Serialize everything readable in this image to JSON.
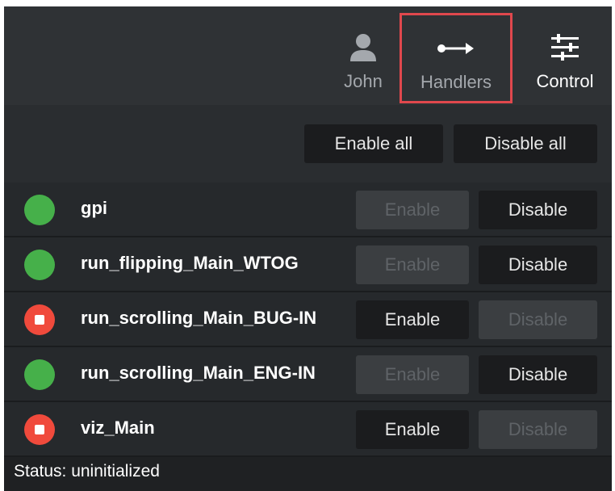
{
  "nav": {
    "user_label": "John",
    "handlers_label": "Handlers",
    "control_label": "Control"
  },
  "bulk": {
    "enable_all": "Enable all",
    "disable_all": "Disable all"
  },
  "handlers": [
    {
      "name": "gpi",
      "status": "running",
      "enable_label": "Enable",
      "disable_label": "Disable"
    },
    {
      "name": "run_flipping_Main_WTOG",
      "status": "running",
      "enable_label": "Enable",
      "disable_label": "Disable"
    },
    {
      "name": "run_scrolling_Main_BUG-IN",
      "status": "stopped",
      "enable_label": "Enable",
      "disable_label": "Disable"
    },
    {
      "name": "run_scrolling_Main_ENG-IN",
      "status": "running",
      "enable_label": "Enable",
      "disable_label": "Disable"
    },
    {
      "name": "viz_Main",
      "status": "stopped",
      "enable_label": "Enable",
      "disable_label": "Disable"
    }
  ],
  "status_text": "Status: uninitialized",
  "colors": {
    "running": "#46b04a",
    "stopped": "#f04a3c",
    "highlight_border": "#e0484d"
  }
}
